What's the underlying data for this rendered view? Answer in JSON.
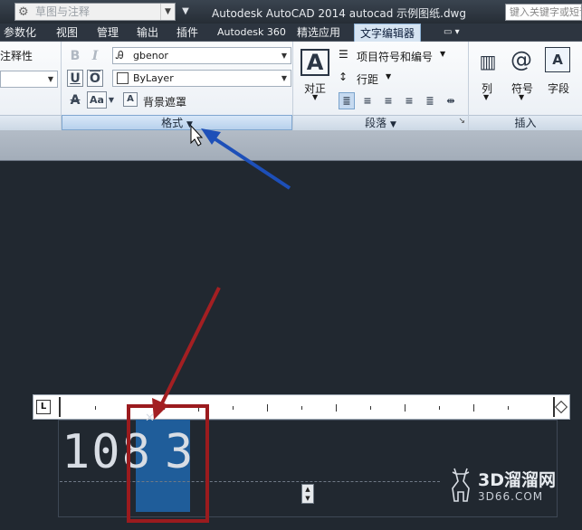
{
  "titlebar": {
    "workspace": "草图与注释",
    "app_title": "Autodesk AutoCAD 2014    autocad 示例图纸.dwg",
    "search_placeholder": "键入关键字或短语"
  },
  "tabs": [
    {
      "label": "参数化"
    },
    {
      "label": "视图"
    },
    {
      "label": "管理"
    },
    {
      "label": "输出"
    },
    {
      "label": "插件"
    },
    {
      "label": "Autodesk 360"
    },
    {
      "label": "精选应用"
    },
    {
      "label": "文字编辑器"
    }
  ],
  "ribbon": {
    "style_panel": {
      "label": "注释性",
      "partial_label": "注释性"
    },
    "format_panel": {
      "label": "格式",
      "bold": "B",
      "italic": "I",
      "underline": "U",
      "overline": "O",
      "strike": "A",
      "case": "Aa",
      "font": "gbenor",
      "color": "ByLayer",
      "background_mask": "背景遮罩"
    },
    "paragraph_panel": {
      "label": "段落",
      "justify": "对正",
      "bullets": "项目符号和编号",
      "line_spacing": "行距"
    },
    "insert_panel": {
      "label": "插入",
      "columns": "列",
      "symbol": "符号",
      "field": "字段"
    }
  },
  "editor": {
    "text_before": "108",
    "text_selected": "3",
    "ruler_corner": "L"
  },
  "watermark": {
    "brand": "3D溜溜网",
    "domain": "3D66.COM"
  },
  "colors": {
    "canvas": "#212830",
    "ribbon_highlight": "#b8d1ec",
    "selection": "#1f5d9a",
    "red_annotation": "#9b1b1e",
    "blue_annotation": "#1d4fb8"
  }
}
